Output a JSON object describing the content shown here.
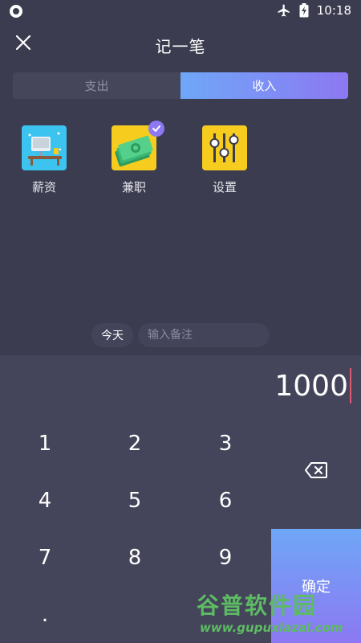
{
  "status_bar": {
    "time": "10:18"
  },
  "header": {
    "title": "记一笔"
  },
  "tabs": [
    {
      "label": "支出",
      "active": false
    },
    {
      "label": "收入",
      "active": true
    }
  ],
  "categories": [
    {
      "label": "薪资",
      "icon": "salary-icon",
      "color": "#3cc3f0"
    },
    {
      "label": "兼职",
      "icon": "part-time-money-icon",
      "color": "#f6cd1e",
      "selected": true
    },
    {
      "label": "设置",
      "icon": "settings-sliders-icon",
      "color": "#f6cd1e"
    }
  ],
  "note": {
    "date_label": "今天",
    "placeholder": "输入备注"
  },
  "amount": "1000",
  "keypad": {
    "keys": [
      "1",
      "2",
      "3",
      "4",
      "5",
      "6",
      "7",
      "8",
      "9",
      "."
    ],
    "confirm_label": "确定"
  },
  "watermark": {
    "title": "谷普软件园",
    "url": "www.gupuxlazal.com"
  },
  "colors": {
    "accent_start": "#6fa7f7",
    "accent_end": "#8c78f2",
    "background": "#3b3c4f",
    "keypad_bg": "#44455a",
    "cursor": "#e05872"
  }
}
